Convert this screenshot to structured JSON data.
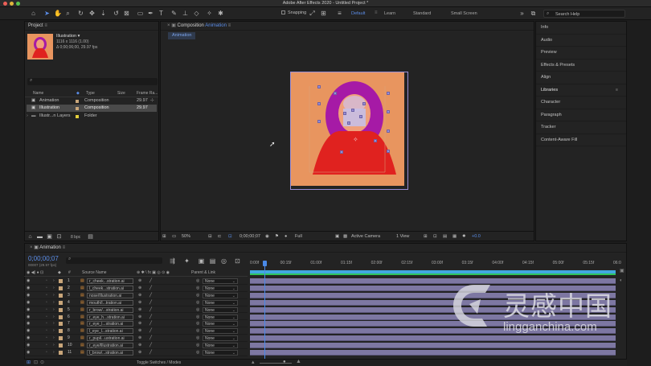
{
  "app": {
    "title": "Adobe After Effects 2020 - Untitled Project *"
  },
  "toolbar": {
    "snapping_label": "Snapping",
    "workspaces": [
      "Default",
      "Learn",
      "Standard",
      "Small Screen"
    ],
    "active_workspace": "Default",
    "search_placeholder": "Search Help"
  },
  "project": {
    "panel_title": "Project",
    "selected_item": {
      "name": "Illustration ▾",
      "dims": "1116 x 1116 (1.00)",
      "duration": "Δ 0;00;06;00, 29.97 fps"
    },
    "columns": {
      "name": "Name",
      "type": "Type",
      "size": "Size",
      "frame_rate": "Frame Ra..."
    },
    "items": [
      {
        "name": "Animation",
        "type": "Composition",
        "frame_rate": "29.97"
      },
      {
        "name": "Illustration",
        "type": "Composition",
        "frame_rate": "29.97"
      },
      {
        "name": "Illustr...n Layers",
        "type": "Folder",
        "frame_rate": ""
      }
    ],
    "bpc": "8 bpc"
  },
  "composition": {
    "panel_title": "Composition",
    "comp_name": "Animation",
    "tab": "Animation",
    "zoom": "50%",
    "timecode": "0;00;00;07",
    "resolution": "Full",
    "camera": "Active Camera",
    "view": "1 View",
    "exposure": "+0.0"
  },
  "right_panels": [
    "Info",
    "Audio",
    "Preview",
    "Effects & Presets",
    "Align",
    "Libraries",
    "Character",
    "Paragraph",
    "Tracker",
    "Content-Aware Fill"
  ],
  "timeline": {
    "tab": "Animation",
    "timecode": "0;00;00;07",
    "frame_info": "00007 (29.97 fps)",
    "columns": {
      "source_name": "Source Name",
      "parent_link": "Parent & Link"
    },
    "ruler_labels": [
      "0:00f",
      "00:15f",
      "01:00f",
      "01:15f",
      "02:00f",
      "02:15f",
      "03:00f",
      "03:15f",
      "04:00f",
      "04:15f",
      "05:00f",
      "05:15f",
      "06:0"
    ],
    "layers": [
      {
        "num": "1",
        "name": "r_cheek...stration.ai",
        "parent": "None"
      },
      {
        "num": "2",
        "name": "l_cheek...stration.ai",
        "parent": "None"
      },
      {
        "num": "3",
        "name": "nose/Illustration.ai",
        "parent": "None"
      },
      {
        "num": "4",
        "name": "mouth/I...tration.ai",
        "parent": "None"
      },
      {
        "num": "5",
        "name": "r_brow/...stration.ai",
        "parent": "None"
      },
      {
        "num": "6",
        "name": "r_eye_h...stration.ai",
        "parent": "None"
      },
      {
        "num": "7",
        "name": "r_eye_l...stration.ai",
        "parent": "None"
      },
      {
        "num": "8",
        "name": "l_eye_l...stration.ai",
        "parent": "None"
      },
      {
        "num": "9",
        "name": "r_pupil...ustration.ai",
        "parent": "None"
      },
      {
        "num": "10",
        "name": "r_eye/Illustration.ai",
        "parent": "None"
      },
      {
        "num": "11",
        "name": "l_brow/...stration.ai",
        "parent": "None"
      }
    ],
    "toggle_label": "Toggle Switches / Modes"
  },
  "watermark": {
    "cn": "灵感中国",
    "url": "lingganchina.com"
  },
  "colors": {
    "accent": "#5b8de8",
    "comp_bg": "#e8955f",
    "figure_red": "#e0221f",
    "hair_purple": "#a61aa6",
    "layer_bar": "#7d77a2",
    "label_tan": "#c9a67a"
  }
}
